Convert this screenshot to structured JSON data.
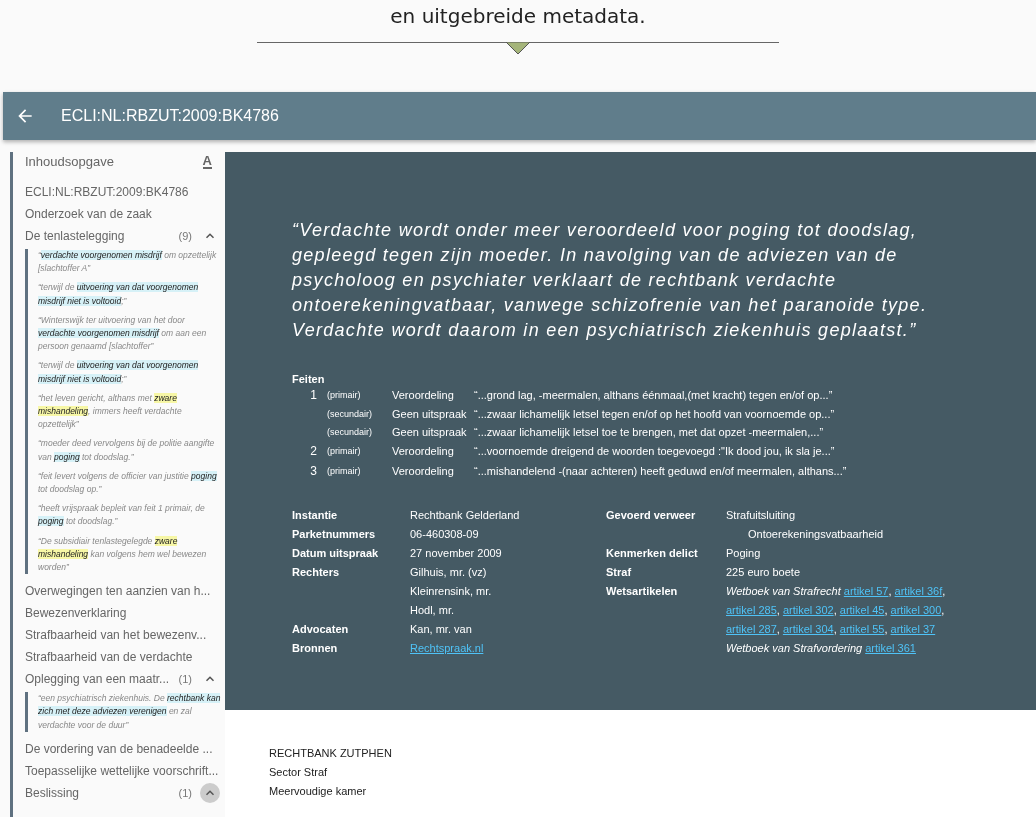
{
  "intro": {
    "text": "en uitgebreide metadata."
  },
  "header": {
    "title": "ECLI:NL:RBZUT:2009:BK4786"
  },
  "toc": {
    "title": "Inhoudsopgave",
    "font_button": "A",
    "items": [
      {
        "label": "ECLI:NL:RBZUT:2009:BK4786"
      },
      {
        "label": "Onderzoek van de zaak"
      },
      {
        "label": "De tenlastelegging",
        "count": "(9)",
        "expanded": true,
        "hovered": false,
        "snippets": [
          [
            {
              "text": "“",
              "kind": "plain"
            },
            {
              "text": "verdachte voorgenomen misdrijf",
              "kind": "match"
            },
            {
              "text": " om opzettelijk [slachtoffer A”",
              "kind": "plain"
            }
          ],
          [
            {
              "text": "“terwijl de ",
              "kind": "plain"
            },
            {
              "text": "uitvoering van dat voorgenomen misdrijf niet is voltooid",
              "kind": "match"
            },
            {
              "text": ";”",
              "kind": "plain"
            }
          ],
          [
            {
              "text": "“Winterswijk ter uitvoering van het door ",
              "kind": "plain"
            },
            {
              "text": "verdachte voorgenomen misdrijf",
              "kind": "match"
            },
            {
              "text": " om aan een persoon genaamd [slachtoffer”",
              "kind": "plain"
            }
          ],
          [
            {
              "text": "“terwijl de ",
              "kind": "plain"
            },
            {
              "text": "uitvoering van dat voorgenomen misdrijf niet is voltooid",
              "kind": "match"
            },
            {
              "text": ";”",
              "kind": "plain"
            }
          ],
          [
            {
              "text": "“het leven gericht, althans met ",
              "kind": "plain"
            },
            {
              "text": "zware mishandeling",
              "kind": "term"
            },
            {
              "text": ", immers heeft verdachte opzettelijk”",
              "kind": "plain"
            }
          ],
          [
            {
              "text": "“moeder deed vervolgens bij de politie aangifte van ",
              "kind": "plain"
            },
            {
              "text": "poging",
              "kind": "match"
            },
            {
              "text": " tot doodslag.”",
              "kind": "plain"
            }
          ],
          [
            {
              "text": "“feit levert volgens de officier van justitie ",
              "kind": "plain"
            },
            {
              "text": "poging",
              "kind": "match"
            },
            {
              "text": " tot doodslag op.”",
              "kind": "plain"
            }
          ],
          [
            {
              "text": "“heeft vrijspraak bepleit van feit 1 primair, de ",
              "kind": "plain"
            },
            {
              "text": "poging",
              "kind": "match"
            },
            {
              "text": " tot doodslag.”",
              "kind": "plain"
            }
          ],
          [
            {
              "text": "“De subsidiair tenlastegelegde ",
              "kind": "plain"
            },
            {
              "text": "zware mishandeling",
              "kind": "term"
            },
            {
              "text": " kan volgens hem wel bewezen worden”",
              "kind": "plain"
            }
          ]
        ]
      },
      {
        "label": "Overwegingen ten aanzien van h..."
      },
      {
        "label": "Bewezenverklaring"
      },
      {
        "label": "Strafbaarheid van het bewezenv..."
      },
      {
        "label": "Strafbaarheid van de verdachte"
      },
      {
        "label": "Oplegging van een maatr...",
        "count": "(1)",
        "expanded": true,
        "hovered": false,
        "snippets": [
          [
            {
              "text": "“een psychiatrisch ziekenhuis. De ",
              "kind": "plain"
            },
            {
              "text": "rechtbank kan zich met deze adviezen verenigen",
              "kind": "match"
            },
            {
              "text": " en zal verdachte voor de duur”",
              "kind": "plain"
            }
          ]
        ]
      },
      {
        "label": "De vordering van de benadeelde ..."
      },
      {
        "label": "Toepasselijke wettelijke voorschrift..."
      },
      {
        "label": "Beslissing",
        "count": "(1)",
        "expanded": true,
        "hovered": true
      }
    ]
  },
  "summary": {
    "quote": "“Verdachte wordt onder meer veroordeeld voor poging tot doodslag, gepleegd tegen zijn moeder. In navolging van de adviezen van de psycholoog en psychiater verklaart de rechtbank verdachte ontoerekeningvatbaar, vanwege schizofrenie van het paranoide type. Verdachte wordt daarom in een psychiatrisch ziekenhuis geplaatst.”",
    "facts_title": "Feiten",
    "facts": [
      {
        "number": "1",
        "type": "(primair)",
        "outcome": "Veroordeling",
        "excerpt": "“...grond lag, -meermalen, althans éénmaal,(met kracht) tegen en/of op...”"
      },
      {
        "type": "(secundair)",
        "outcome": "Geen uitspraak",
        "excerpt": "“...zwaar lichamelijk letsel tegen en/of op het hoofd van voornoemde op...”"
      },
      {
        "type": "(secundair)",
        "outcome": "Geen uitspraak",
        "excerpt": "“...zwaar lichamelijk letsel toe te brengen, met dat opzet -meermalen,...”"
      },
      {
        "number": "2",
        "type": "(primair)",
        "outcome": "Veroordeling",
        "excerpt": "“...voornoemde dreigend de woorden toegevoegd :\"Ik dood jou, ik sla je...”"
      },
      {
        "number": "3",
        "type": "(primair)",
        "outcome": "Veroordeling",
        "excerpt": "“...mishandelend -(naar achteren) heeft geduwd en/of meermalen, althans...”"
      }
    ],
    "metadata_left": [
      {
        "label": "Instantie",
        "lines": [
          [
            {
              "text": "Rechtbank Gelderland",
              "kind": "plain"
            }
          ]
        ]
      },
      {
        "label": "Parketnummers",
        "lines": [
          [
            {
              "text": "06-460308-09",
              "kind": "plain"
            }
          ]
        ]
      },
      {
        "label": "Datum uitspraak",
        "lines": [
          [
            {
              "text": "27 november 2009",
              "kind": "plain"
            }
          ]
        ]
      },
      {
        "label": "Rechters",
        "lines": [
          [
            {
              "text": "Gilhuis, mr. (vz)",
              "kind": "plain"
            }
          ],
          [
            {
              "text": "Kleinrensink, mr.",
              "kind": "plain"
            }
          ],
          [
            {
              "text": "Hodl, mr.",
              "kind": "plain"
            }
          ]
        ]
      },
      {
        "label": "Advocaten",
        "lines": [
          [
            {
              "text": "Kan, mr. van",
              "kind": "plain"
            }
          ]
        ]
      },
      {
        "label": "Bronnen",
        "lines": [
          [
            {
              "text": "Rechtspraak.nl",
              "kind": "link"
            }
          ]
        ]
      }
    ],
    "metadata_right": [
      {
        "label": "Gevoerd verweer",
        "lines": [
          [
            {
              "text": "Strafuitsluiting",
              "kind": "plain"
            }
          ],
          [
            {
              "text": "Ontoerekeningsvatbaarheid",
              "kind": "sub"
            }
          ]
        ]
      },
      {
        "label": "Kenmerken delict",
        "lines": [
          [
            {
              "text": "Poging",
              "kind": "plain"
            }
          ]
        ]
      },
      {
        "label": "Straf",
        "lines": [
          [
            {
              "text": "225 euro boete",
              "kind": "plain"
            }
          ]
        ]
      },
      {
        "label": "Wetsartikelen",
        "lines": [
          [
            {
              "text": "Wetboek van Strafrecht ",
              "kind": "italic"
            },
            {
              "text": "artikel 57",
              "kind": "link"
            },
            {
              "text": ", ",
              "kind": "plain"
            },
            {
              "text": "artikel 36f",
              "kind": "link"
            },
            {
              "text": ",",
              "kind": "plain"
            }
          ],
          [
            {
              "text": "artikel 285",
              "kind": "link"
            },
            {
              "text": ", ",
              "kind": "plain"
            },
            {
              "text": "artikel 302",
              "kind": "link"
            },
            {
              "text": ", ",
              "kind": "plain"
            },
            {
              "text": "artikel 45",
              "kind": "link"
            },
            {
              "text": ", ",
              "kind": "plain"
            },
            {
              "text": "artikel 300",
              "kind": "link"
            },
            {
              "text": ",",
              "kind": "plain"
            }
          ],
          [
            {
              "text": "artikel 287",
              "kind": "link"
            },
            {
              "text": ", ",
              "kind": "plain"
            },
            {
              "text": "artikel 304",
              "kind": "link"
            },
            {
              "text": ", ",
              "kind": "plain"
            },
            {
              "text": "artikel 55",
              "kind": "link"
            },
            {
              "text": ", ",
              "kind": "plain"
            },
            {
              "text": "artikel 37",
              "kind": "link"
            }
          ],
          [
            {
              "text": "Wetboek van Strafvordering ",
              "kind": "italic"
            },
            {
              "text": "artikel 361",
              "kind": "link"
            }
          ]
        ]
      }
    ]
  },
  "document": {
    "lines": [
      "RECHTBANK ZUTPHEN",
      "Sector Straf",
      "Meervoudige kamer"
    ]
  }
}
